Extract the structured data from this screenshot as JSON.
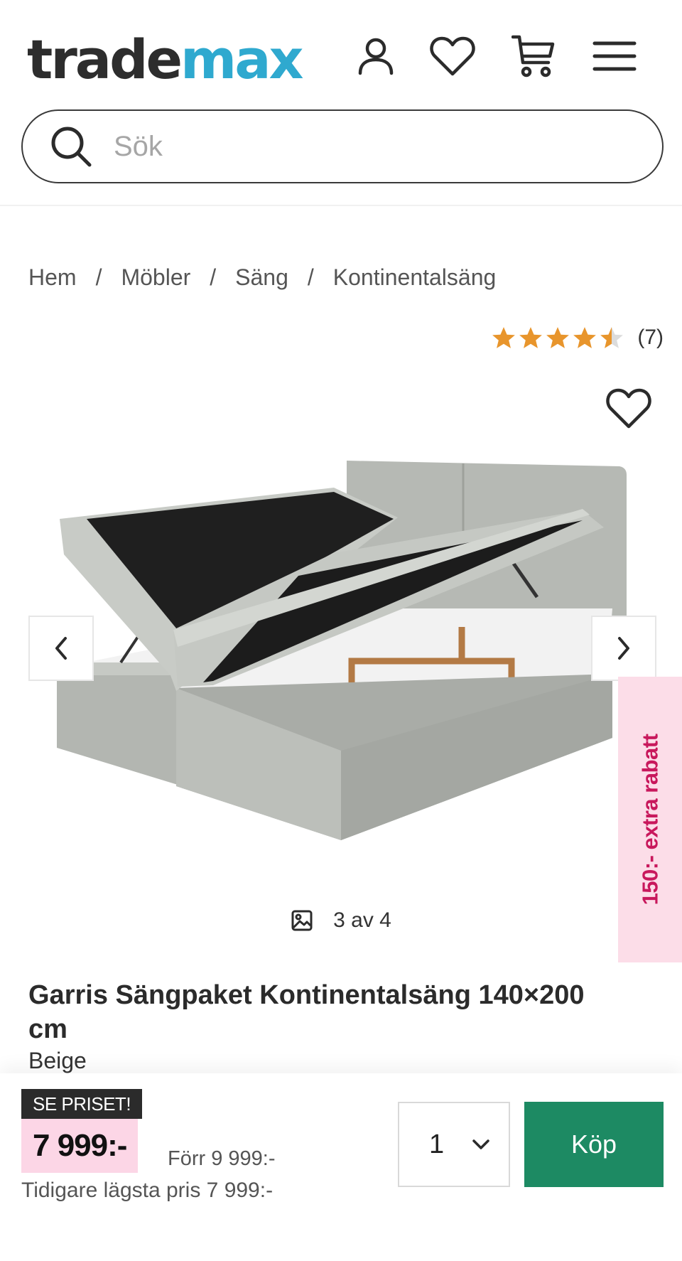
{
  "header": {
    "logo_part1": "trade",
    "logo_part2": "max",
    "search_placeholder": "Sök"
  },
  "breadcrumb": [
    "Hem",
    "Möbler",
    "Säng",
    "Kontinentalsäng"
  ],
  "rating": {
    "stars": 4.5,
    "max_stars": 5,
    "count_label": "(7)",
    "star_color": "#e8952c"
  },
  "gallery": {
    "counter": "3 av 4"
  },
  "promo": {
    "label": "150:- extra rabatt"
  },
  "product": {
    "title": "Garris Sängpaket Kontinentalsäng 140×200 cm",
    "variant": "Beige"
  },
  "purchase": {
    "badge": "SE PRISET!",
    "price": "7 999:-",
    "before_price": "Förr 9 999:-",
    "lowest_price": "Tidigare lägsta pris 7 999:-",
    "quantity": "1",
    "buy_label": "Köp"
  },
  "colors": {
    "brand_blue": "#2fa9cf",
    "buy_green": "#1d8a63",
    "promo_pink": "#c8185c",
    "price_bg": "#fcd6e6"
  }
}
